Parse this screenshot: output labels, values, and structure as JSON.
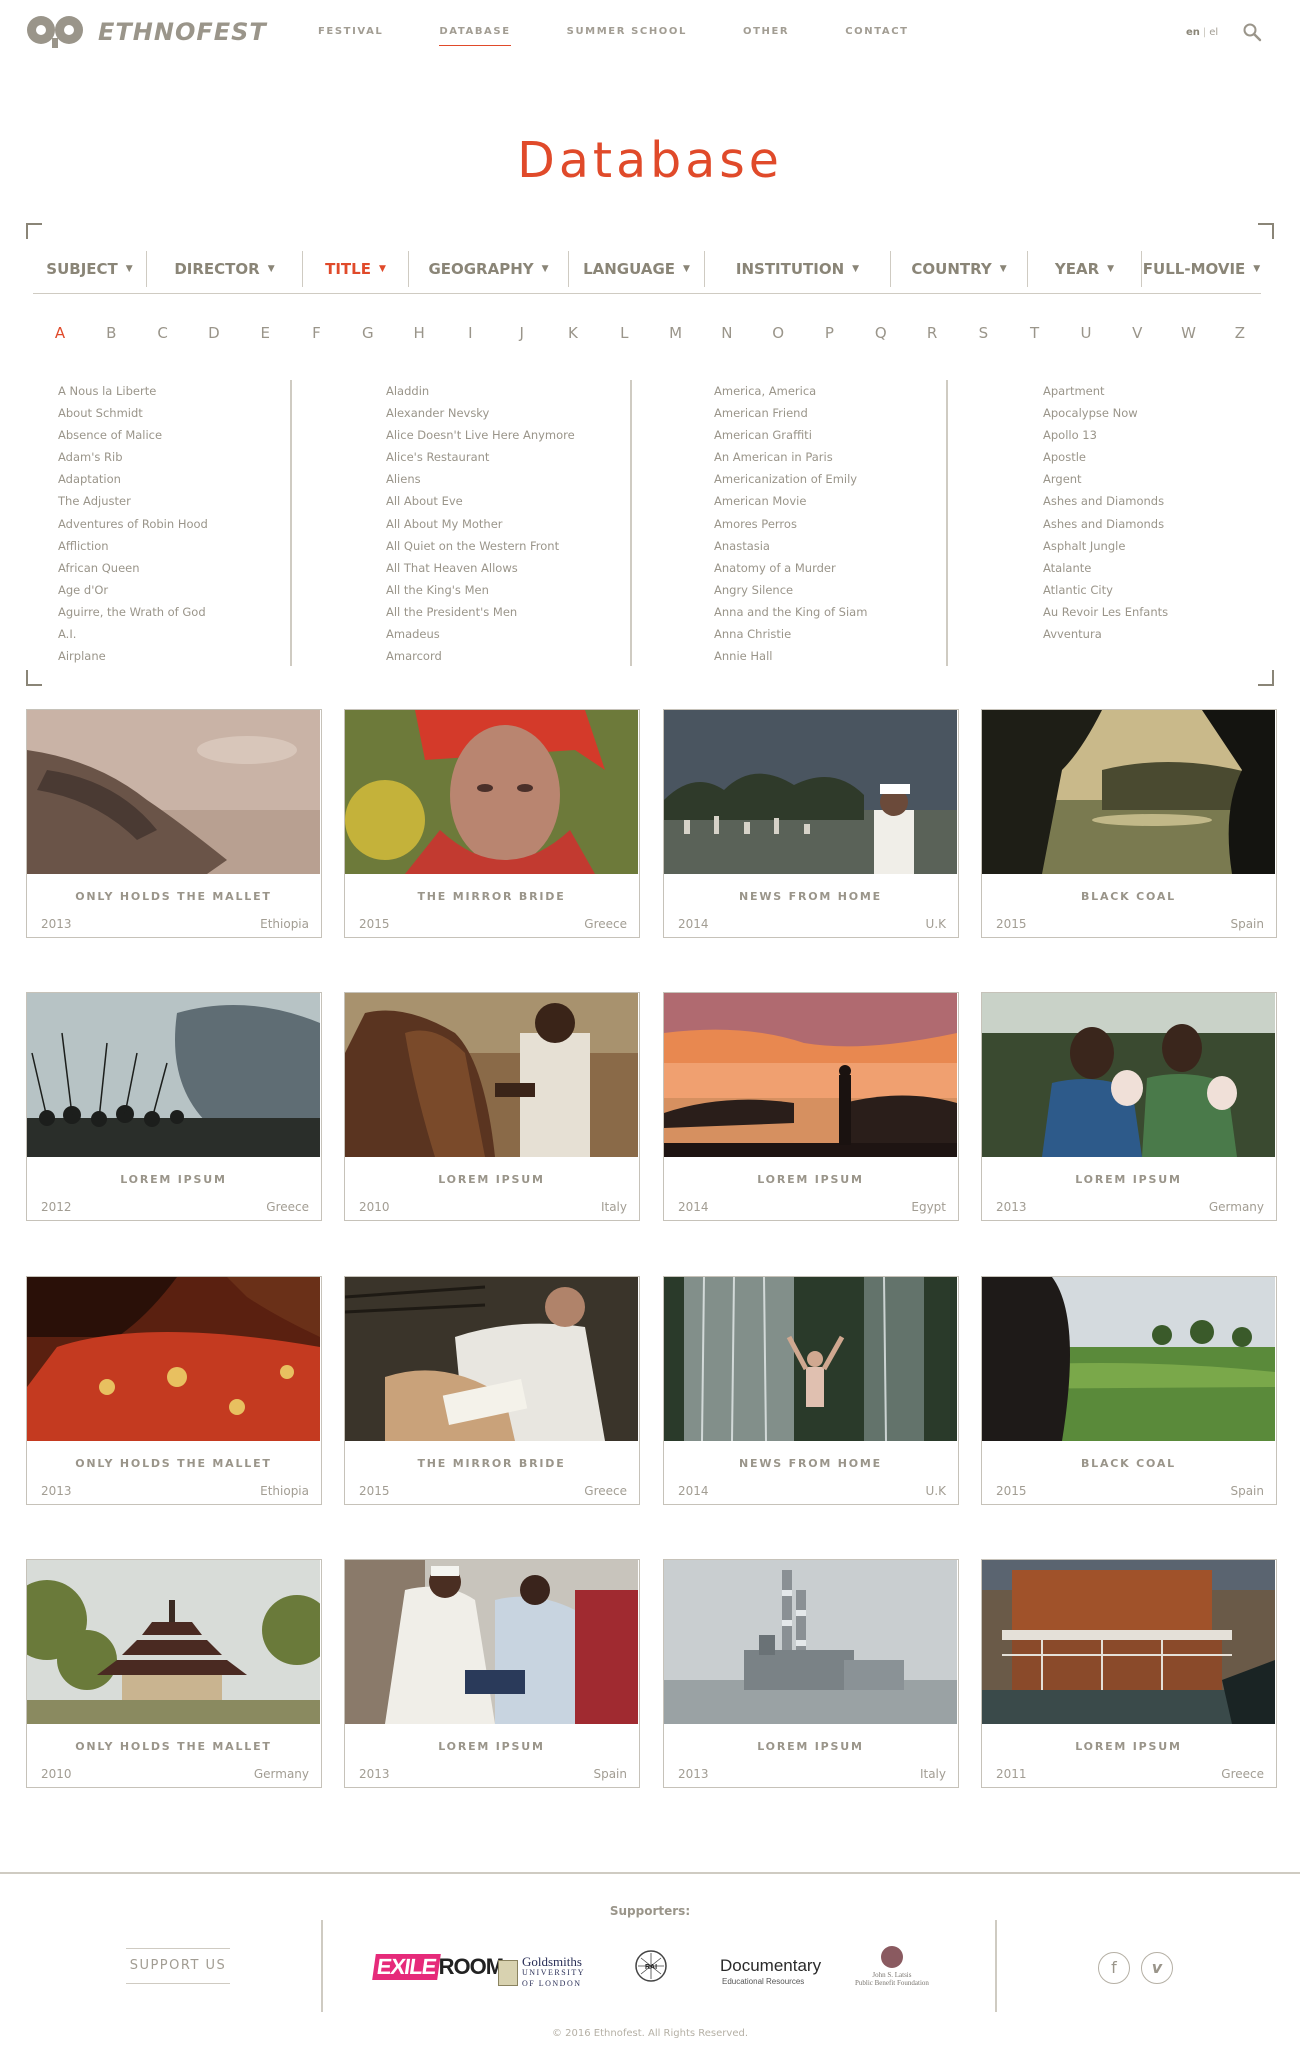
{
  "header": {
    "logo_text": "ETHNOFEST",
    "nav": [
      "FESTIVAL",
      "DATABASE",
      "SUMMER SCHOOL",
      "OTHER",
      "CONTACT"
    ],
    "nav_active": "DATABASE",
    "lang_en": "en",
    "lang_sep": "|",
    "lang_el": "el"
  },
  "page_title": "Database",
  "filters": [
    {
      "label": "SUBJECT",
      "arrow": "▼"
    },
    {
      "label": "DIRECTOR",
      "arrow": "▼"
    },
    {
      "label": "TITLE",
      "arrow": "▼",
      "active": true
    },
    {
      "label": "GEOGRAPHY",
      "arrow": "▼"
    },
    {
      "label": "LANGUAGE",
      "arrow": "▼"
    },
    {
      "label": "INSTITUTION",
      "arrow": "▼"
    },
    {
      "label": "COUNTRY",
      "arrow": "▼"
    },
    {
      "label": "YEAR",
      "arrow": "▼"
    },
    {
      "label": "FULL-MOVIE",
      "arrow": "▼"
    }
  ],
  "alphabet": [
    "A",
    "B",
    "C",
    "D",
    "E",
    "F",
    "G",
    "H",
    "I",
    "J",
    "K",
    "L",
    "M",
    "N",
    "O",
    "P",
    "Q",
    "R",
    "S",
    "T",
    "U",
    "V",
    "W",
    "Z"
  ],
  "alphabet_active": "A",
  "title_columns": [
    [
      "A Nous la Liberte",
      "About Schmidt",
      "Absence of Malice",
      "Adam's Rib",
      "Adaptation",
      "The Adjuster",
      "Adventures of Robin Hood",
      "Affliction",
      "African Queen",
      "Age d'Or",
      "Aguirre, the Wrath of God",
      "A.I.",
      "Airplane"
    ],
    [
      "Aladdin",
      "Alexander Nevsky",
      "Alice Doesn't Live Here Anymore",
      "Alice's Restaurant",
      "Aliens",
      "All About Eve",
      "All About My Mother",
      "All Quiet on the Western Front",
      "All That Heaven Allows",
      "All the King's Men",
      "All the President's Men",
      "Amadeus",
      "Amarcord"
    ],
    [
      "America, America",
      "American Friend",
      "American Graffiti",
      "An American in Paris",
      "Americanization of Emily",
      "American Movie",
      "Amores Perros",
      "Anastasia",
      "Anatomy of a Murder",
      "Angry Silence",
      "Anna and the King of Siam",
      "Anna Christie",
      "Annie Hall"
    ],
    [
      "Apartment",
      "Apocalypse Now",
      "Apollo 13",
      "Apostle",
      "Argent",
      "Ashes and Diamonds",
      "Ashes and Diamonds",
      "Asphalt Jungle",
      "Atalante",
      "Atlantic City",
      "Au Revoir Les Enfants",
      "Avventura"
    ]
  ],
  "films": [
    {
      "title": "ONLY HOLDS THE MALLET",
      "year": "2013",
      "country": "Ethiopia",
      "scene": "sand-feet"
    },
    {
      "title": "THE MIRROR BRIDE",
      "year": "2015",
      "country": "Greece",
      "scene": "portrait-woman"
    },
    {
      "title": "NEWS FROM HOME",
      "year": "2014",
      "country": "U.K",
      "scene": "cemetery"
    },
    {
      "title": "BLACK COAL",
      "year": "2015",
      "country": "Spain",
      "scene": "river-tree"
    },
    {
      "title": "LOREM IPSUM",
      "year": "2012",
      "country": "Greece",
      "scene": "sky-spears"
    },
    {
      "title": "LOREM IPSUM",
      "year": "2010",
      "country": "Italy",
      "scene": "horse"
    },
    {
      "title": "LOREM IPSUM",
      "year": "2014",
      "country": "Egypt",
      "scene": "sunset"
    },
    {
      "title": "LOREM IPSUM",
      "year": "2013",
      "country": "Germany",
      "scene": "women-children"
    },
    {
      "title": "ONLY HOLDS THE MALLET",
      "year": "2013",
      "country": "Ethiopia",
      "scene": "red-cloth"
    },
    {
      "title": "THE MIRROR BRIDE",
      "year": "2015",
      "country": "Greece",
      "scene": "craftsman"
    },
    {
      "title": "NEWS FROM HOME",
      "year": "2014",
      "country": "U.K",
      "scene": "waterfall"
    },
    {
      "title": "BLACK COAL",
      "year": "2015",
      "country": "Spain",
      "scene": "rice-field"
    },
    {
      "title": "ONLY HOLDS THE MALLET",
      "year": "2010",
      "country": "Germany",
      "scene": "pagoda"
    },
    {
      "title": "LOREM IPSUM",
      "year": "2013",
      "country": "Spain",
      "scene": "market"
    },
    {
      "title": "LOREM IPSUM",
      "year": "2013",
      "country": "Italy",
      "scene": "factory"
    },
    {
      "title": "LOREM IPSUM",
      "year": "2011",
      "country": "Greece",
      "scene": "boat"
    }
  ],
  "footer": {
    "supporters_label": "Supporters:",
    "support_button": "SUPPORT US",
    "sponsors": {
      "exile_a": "EXILE",
      "exile_b": "ROOM",
      "goldsmiths_a": "Goldsmiths",
      "goldsmiths_b": "UNIVERSITY",
      "goldsmiths_c": "OF LONDON",
      "rai": "RAI",
      "docu_a": "Documentary",
      "docu_b": "Educational Resources",
      "latsis_a": "John S. Latsis",
      "latsis_b": "Public Benefit Foundation"
    },
    "social": [
      "facebook-icon",
      "vimeo-icon"
    ],
    "copyright": "© 2016 Ethnofest. All Rights Reserved."
  },
  "colors": {
    "accent": "#e04a2a",
    "text": "#8a8577",
    "border": "#c6c2b9"
  }
}
